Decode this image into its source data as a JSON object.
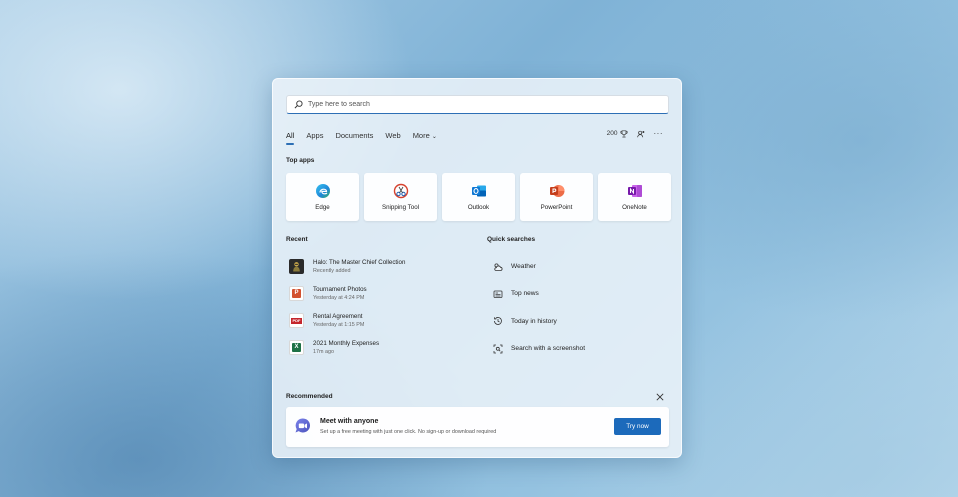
{
  "search": {
    "placeholder": "Type here to search"
  },
  "tabs": [
    {
      "label": "All"
    },
    {
      "label": "Apps"
    },
    {
      "label": "Documents"
    },
    {
      "label": "Web"
    },
    {
      "label": "More"
    }
  ],
  "toolbar": {
    "points": "200"
  },
  "top_apps": {
    "heading": "Top apps",
    "items": [
      {
        "label": "Edge",
        "icon": "edge-icon"
      },
      {
        "label": "Snipping Tool",
        "icon": "snipping-tool-icon"
      },
      {
        "label": "Outlook",
        "icon": "outlook-icon"
      },
      {
        "label": "PowerPoint",
        "icon": "powerpoint-icon"
      },
      {
        "label": "OneNote",
        "icon": "onenote-icon"
      }
    ]
  },
  "recent": {
    "heading": "Recent",
    "items": [
      {
        "title": "Halo: The Master Chief Collection",
        "sub": "Recently added",
        "icon": "halo-icon"
      },
      {
        "title": "Tournament Photos",
        "sub": "Yesterday at 4:24 PM",
        "icon": "powerpoint-file-icon"
      },
      {
        "title": "Rental Agreement",
        "sub": "Yesterday at 1:15 PM",
        "icon": "pdf-file-icon"
      },
      {
        "title": "2021 Monthly Expenses",
        "sub": "17m ago",
        "icon": "excel-file-icon"
      }
    ]
  },
  "quick_searches": {
    "heading": "Quick searches",
    "items": [
      {
        "label": "Weather",
        "icon": "weather-icon"
      },
      {
        "label": "Top news",
        "icon": "news-icon"
      },
      {
        "label": "Today in history",
        "icon": "history-icon"
      },
      {
        "label": "Search with a screenshot",
        "icon": "screenshot-search-icon"
      }
    ]
  },
  "recommended": {
    "heading": "Recommended",
    "card_title": "Meet with anyone",
    "card_desc": "Set up a free meeting with just one click. No sign-up or download required",
    "button": "Try now"
  },
  "colors": {
    "accent": "#1c6abb",
    "pdf": "#c4262c",
    "excel": "#1e7145",
    "powerpoint": "#d35230"
  }
}
